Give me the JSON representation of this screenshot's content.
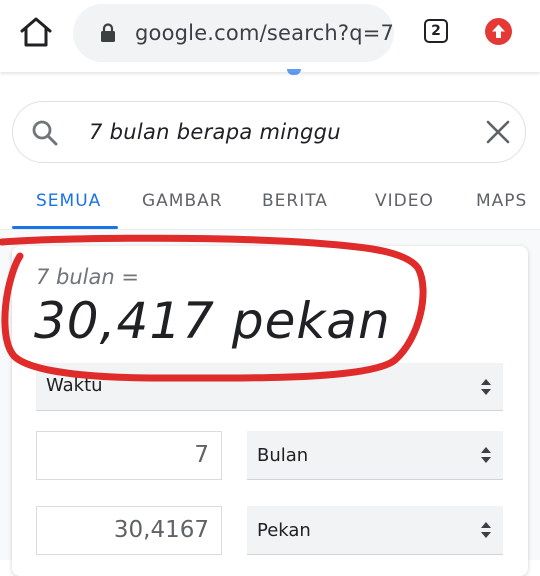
{
  "browser": {
    "url": "google.com/search?q=7+",
    "tab_count": "2",
    "icons": [
      "home-icon",
      "lock-icon",
      "tab-switcher-icon",
      "update-arrow-icon"
    ]
  },
  "search": {
    "query": "7 bulan berapa minggu",
    "icons": [
      "search-icon",
      "clear-icon"
    ]
  },
  "tabs": [
    {
      "label": "SEMUA",
      "active": true
    },
    {
      "label": "GAMBAR",
      "active": false
    },
    {
      "label": "BERITA",
      "active": false
    },
    {
      "label": "VIDEO",
      "active": false
    },
    {
      "label": "MAPS",
      "active": false
    }
  ],
  "converter": {
    "formula": "7 bulan =",
    "result": "30,417 pekan",
    "category": "Waktu",
    "from": {
      "value": "7",
      "unit": "Bulan"
    },
    "to": {
      "value": "30,4167",
      "unit": "Pekan"
    }
  },
  "colors": {
    "accent": "#1a73e8",
    "annotation": "#e02b2b",
    "update_badge": "#e53935"
  }
}
